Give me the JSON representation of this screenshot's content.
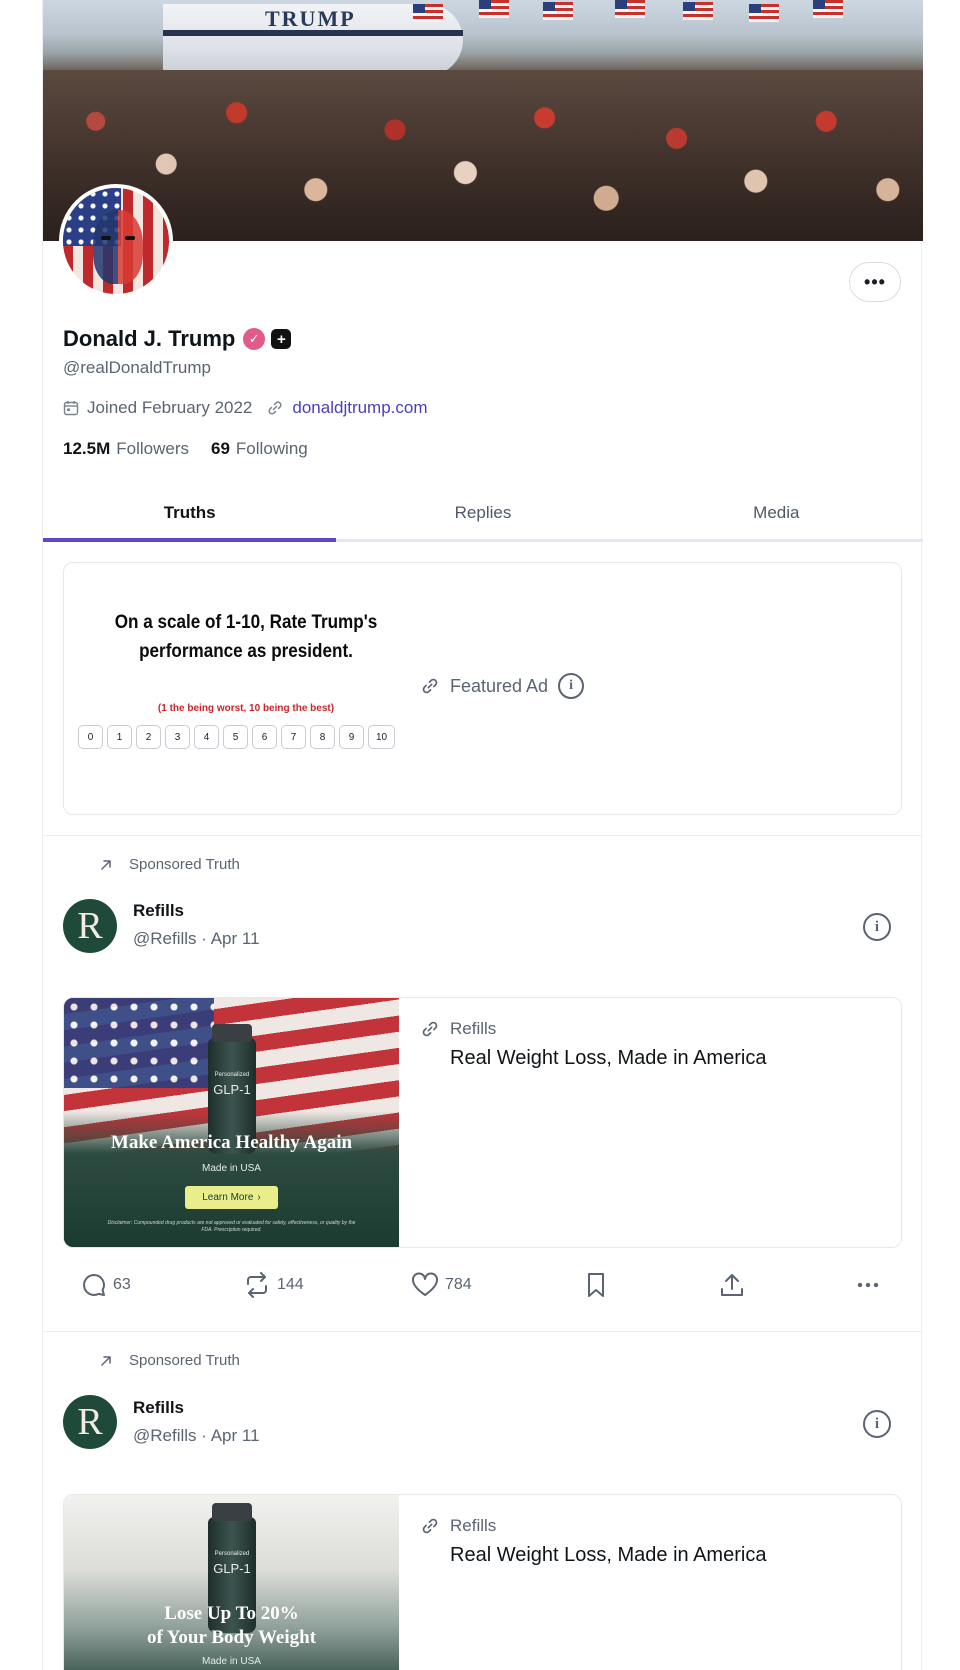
{
  "banner": {
    "plane_text": "TRUMP"
  },
  "profile": {
    "name": "Donald J. Trump",
    "verified_glyph": "✓",
    "plus_glyph": "+",
    "handle": "@realDonaldTrump",
    "joined": "Joined February 2022",
    "website": "donaldjtrump.com",
    "followers_count": "12.5M",
    "followers_label": "Followers",
    "following_count": "69",
    "following_label": "Following",
    "more_label": "•••"
  },
  "tabs": [
    {
      "label": "Truths",
      "active": true
    },
    {
      "label": "Replies",
      "active": false
    },
    {
      "label": "Media",
      "active": false
    }
  ],
  "featured_ad": {
    "poll_title": "On a scale of 1-10, Rate Trump's performance as president.",
    "poll_subtitle": "(1 the being worst, 10 being the best)",
    "scale": [
      "0",
      "1",
      "2",
      "3",
      "4",
      "5",
      "6",
      "7",
      "8",
      "9",
      "10"
    ],
    "label": "Featured Ad",
    "info_glyph": "i"
  },
  "posts": [
    {
      "sponsored_label": "Sponsored Truth",
      "avatar_letter": "R",
      "author": "Refills",
      "handle_date": "@Refills · Apr 11",
      "info_glyph": "i",
      "image": {
        "vial_top": "Personalized",
        "vial_label": "GLP-1",
        "headline": "Make America Healthy Again",
        "sub": "Made in USA",
        "button": "Learn More",
        "button_arrow": "›",
        "disclaimer": "Disclaimer: Compounded drug products are not approved or evaluated for safety, effectiveness, or quality by the FDA. Prescription required."
      },
      "brand": "Refills",
      "ad_headline": "Real Weight Loss, Made in America",
      "stats": {
        "replies": "63",
        "retruths": "144",
        "likes": "784"
      }
    },
    {
      "sponsored_label": "Sponsored Truth",
      "avatar_letter": "R",
      "author": "Refills",
      "handle_date": "@Refills · Apr 11",
      "info_glyph": "i",
      "image": {
        "vial_top": "Personalized",
        "vial_label": "GLP-1",
        "headline_line1": "Lose Up To 20%",
        "headline_line2": "of Your Body Weight",
        "sub": "Made in USA"
      },
      "brand": "Refills",
      "ad_headline": "Real Weight Loss, Made in America"
    }
  ],
  "icons": {
    "calendar": "calendar-icon",
    "link": "link-icon",
    "arrow": "arrow-up-right-icon",
    "reply": "comment-icon",
    "retruth": "repost-icon",
    "like": "heart-icon",
    "bookmark": "bookmark-icon",
    "share": "share-icon",
    "more": "more-icon"
  },
  "colors": {
    "accent": "#5a48d1",
    "link": "#4b3fb8",
    "verified": "#e05a8a",
    "brand_green": "#1f4a3a"
  }
}
